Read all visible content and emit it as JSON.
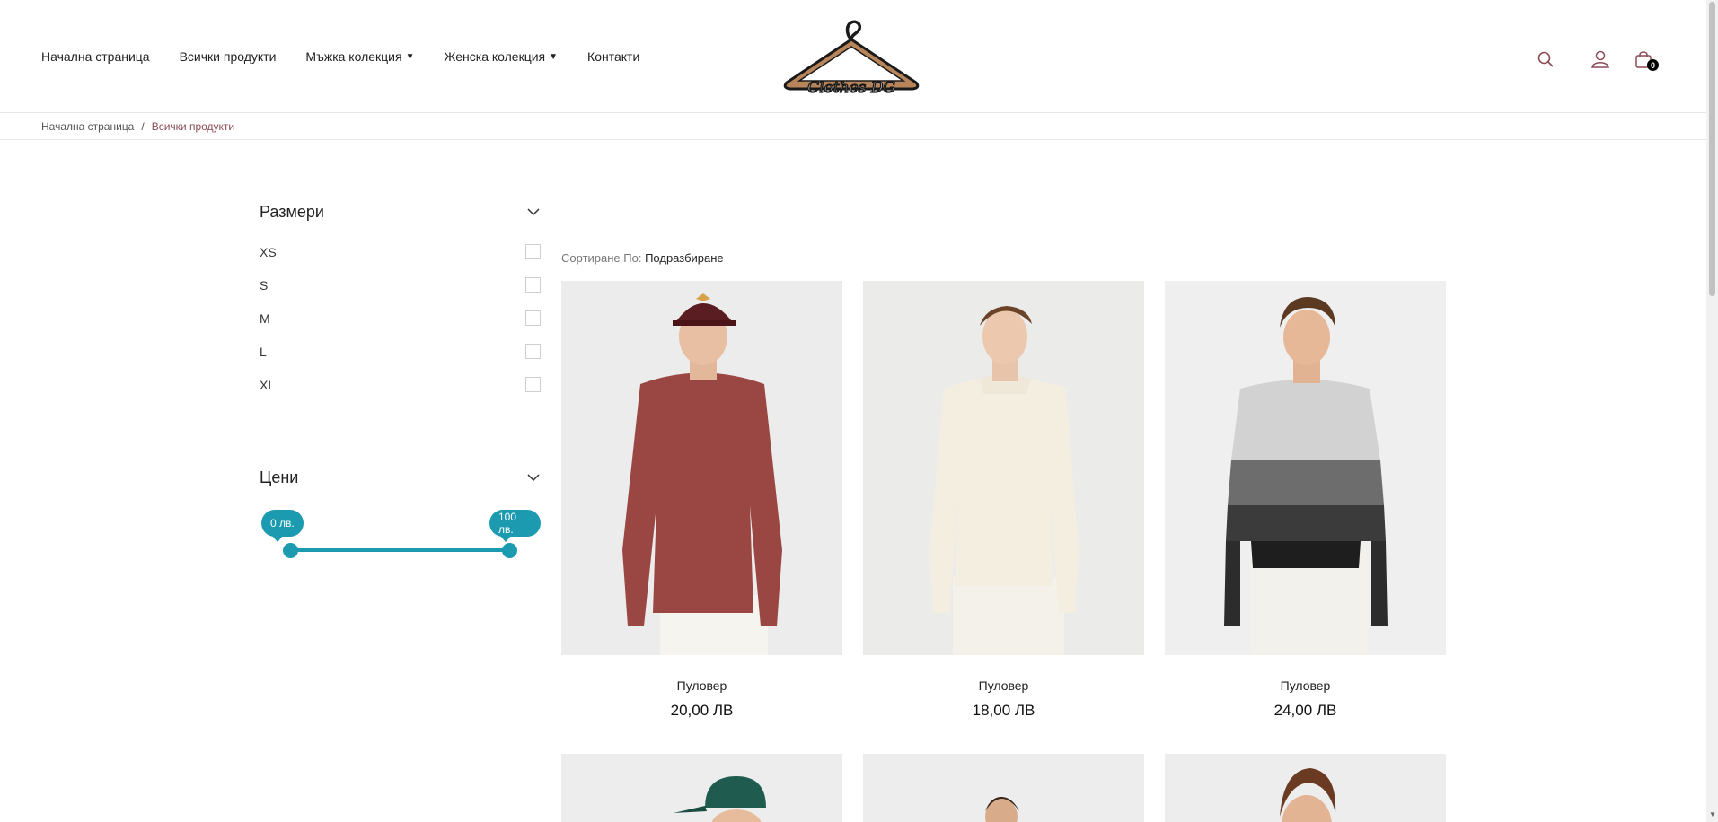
{
  "header": {
    "nav": [
      {
        "label": "Начална страница",
        "dropdown": false
      },
      {
        "label": "Всички продукти",
        "dropdown": false
      },
      {
        "label": "Мъжка колекция",
        "dropdown": true
      },
      {
        "label": "Женска колекция",
        "dropdown": true
      },
      {
        "label": "Контакти",
        "dropdown": false
      }
    ],
    "logo_text": "Clothes DG",
    "cart_count": "0",
    "accent_color": "#8a4b55"
  },
  "breadcrumb": {
    "home": "Начална страница",
    "separator": "/",
    "current": "Всички продукти"
  },
  "filters": {
    "sizes_title": "Размери",
    "sizes": [
      "XS",
      "S",
      "M",
      "L",
      "XL"
    ],
    "price_title": "Цени",
    "price_min_label": "0 лв.",
    "price_max_label": "100 лв.",
    "slider_color": "#1c9bb0"
  },
  "sort": {
    "label": "Сортиране  По:",
    "value": "Подразбиране"
  },
  "products": [
    {
      "name": "Пуловер",
      "price": "20,00 ЛВ",
      "sweater_color": "#9a4743"
    },
    {
      "name": "Пуловер",
      "price": "18,00 ЛВ",
      "sweater_color": "#f3eee0"
    },
    {
      "name": "Пуловер",
      "price": "24,00 ЛВ",
      "sweater_color": "#5a5a5a"
    }
  ]
}
